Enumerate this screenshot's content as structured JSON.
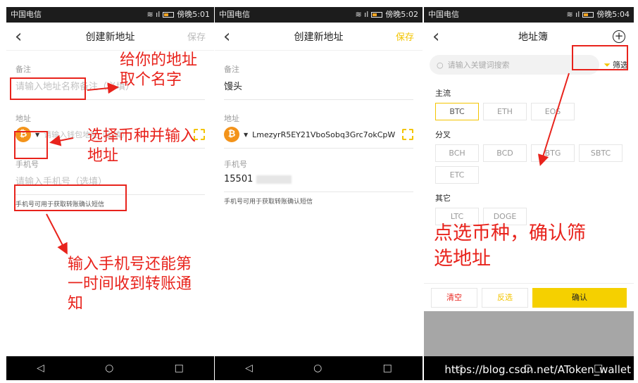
{
  "status_bar": {
    "p1": {
      "carrier": "中国电信",
      "time": "傍晚5:01"
    },
    "p2": {
      "carrier": "中国电信",
      "time": "傍晚5:02"
    },
    "p3": {
      "carrier": "中国电信",
      "time": "傍晚5:04"
    }
  },
  "screen1": {
    "title": "创建新地址",
    "save": "保存",
    "note_label": "备注",
    "note_placeholder": "请输入地址名称备注（必填）",
    "address_label": "地址",
    "address_placeholder": "请输入钱包地址（必填）",
    "phone_label": "手机号",
    "phone_placeholder": "请输入手机号（选填）",
    "phone_hint": "手机号可用于获取转账确认短信"
  },
  "screen2": {
    "title": "创建新地址",
    "save": "保存",
    "note_label": "备注",
    "note_value": "馒头",
    "address_label": "地址",
    "address_value": "LmezyrR5EY21VboSobq3Grc7okCpW",
    "phone_label": "手机号",
    "phone_value": "15501",
    "phone_hint": "手机号可用于获取转账确认短信"
  },
  "screen3": {
    "title": "地址簿",
    "search_placeholder": "请输入关键词搜索",
    "filter_label": "筛选",
    "groups": [
      {
        "title": "主流",
        "chips": [
          {
            "label": "BTC",
            "selected": true
          },
          {
            "label": "ETH",
            "selected": false
          },
          {
            "label": "EOS",
            "selected": false
          }
        ]
      },
      {
        "title": "分叉",
        "chips": [
          {
            "label": "BCH",
            "selected": false
          },
          {
            "label": "BCD",
            "selected": false
          },
          {
            "label": "BTG",
            "selected": false
          },
          {
            "label": "SBTC",
            "selected": false
          },
          {
            "label": "ETC",
            "selected": false
          }
        ]
      },
      {
        "title": "其它",
        "chips": [
          {
            "label": "LTC",
            "selected": false
          },
          {
            "label": "DOGE",
            "selected": false
          }
        ]
      }
    ],
    "clear": "清空",
    "invert": "反选",
    "confirm": "确认"
  },
  "annotations": {
    "a1": "给你的地址\n取个名字",
    "a2": "选择币种并输入\n地址",
    "a3": "输入手机号还能第\n一时间收到转账通\n知",
    "a4": "点选币种，确认筛\n选地址"
  },
  "watermark": "https://blog.csdn.net/AToken_wallet",
  "colors": {
    "accent": "#f3c400",
    "annotation": "#e8231c",
    "bitcoin": "#f3931a"
  },
  "icons": [
    "back-icon",
    "bitcoin-icon",
    "scan-icon",
    "search-icon",
    "filter-icon",
    "plus-circle-icon",
    "nav-back-icon",
    "nav-home-icon",
    "nav-recent-icon"
  ]
}
